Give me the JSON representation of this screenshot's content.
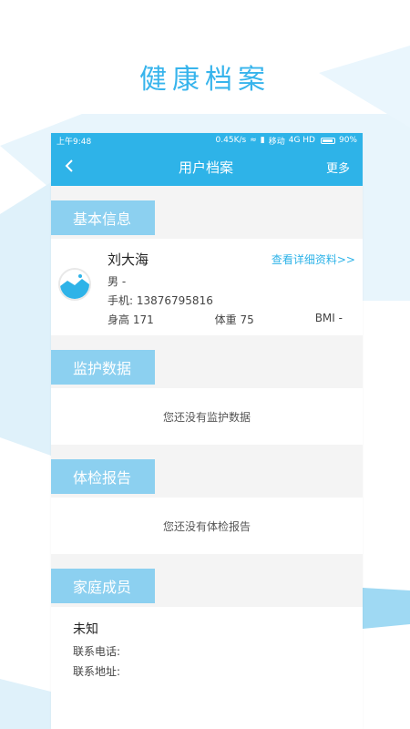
{
  "promo": {
    "title": "健康档案"
  },
  "status_bar": {
    "time": "上午9:48",
    "speed": "0.45K/s",
    "carrier": "移动",
    "network": "4G HD",
    "battery": "90%"
  },
  "navbar": {
    "back_icon": "chevron-left-icon",
    "title": "用户档案",
    "more": "更多"
  },
  "basic_info": {
    "section": "基本信息",
    "name": "刘大海",
    "detail_link": "查看详细资料>>",
    "gender": "男 -",
    "phone": "手机: 13876795816",
    "height": "身高 171",
    "weight": "体重 75",
    "bmi": "BMI -"
  },
  "monitor": {
    "section": "监护数据",
    "empty": "您还没有监护数据"
  },
  "checkup": {
    "section": "体检报告",
    "empty": "您还没有体检报告"
  },
  "family": {
    "section": "家庭成员",
    "member_name": "未知",
    "phone_label": "联系电话:",
    "address_label": "联系地址:"
  },
  "colors": {
    "accent": "#2eb3e8",
    "tag": "#8cd0f0",
    "title": "#37b4ec"
  }
}
